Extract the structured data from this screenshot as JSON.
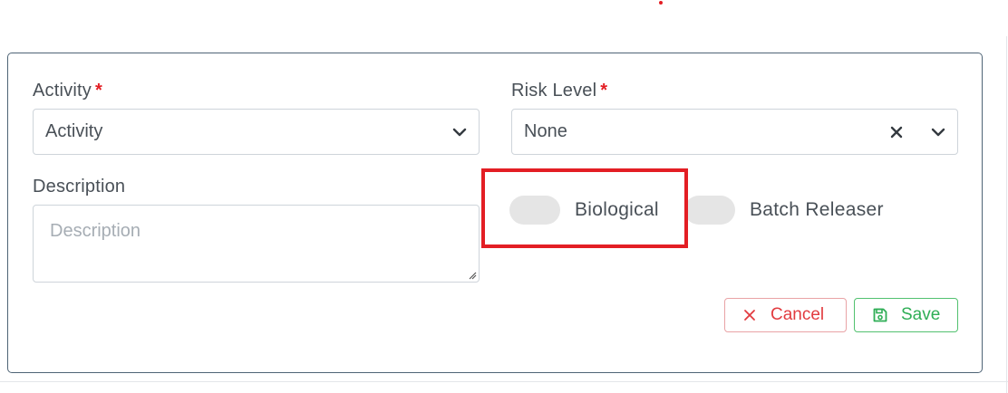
{
  "form": {
    "activity": {
      "label": "Activity",
      "required_mark": "*",
      "value": "Activity"
    },
    "risk_level": {
      "label": "Risk Level",
      "required_mark": "*",
      "value": "None"
    },
    "description": {
      "label": "Description",
      "placeholder": "Description"
    },
    "toggles": [
      {
        "label": "Biological",
        "on": false
      },
      {
        "label": "Batch Releaser",
        "on": false
      }
    ],
    "buttons": {
      "cancel": "Cancel",
      "save": "Save"
    }
  },
  "colors": {
    "required": "#e31e24",
    "cancel": "#e23b3f",
    "save": "#2fae56",
    "card_border": "#4f6476",
    "highlight": "#e31e24"
  },
  "icons": [
    "chevron-down-icon",
    "close-icon",
    "save-icon"
  ]
}
